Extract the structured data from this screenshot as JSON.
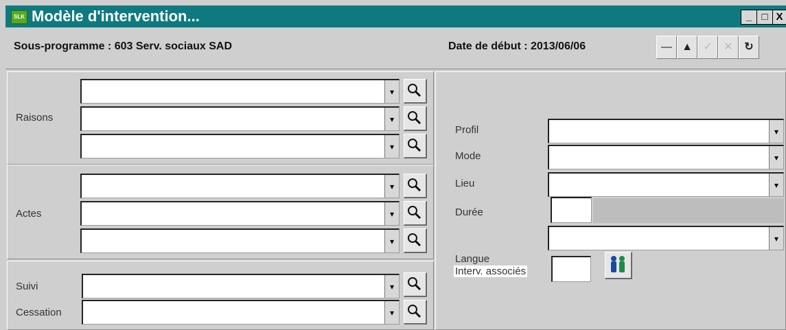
{
  "window": {
    "title": "Modèle d'intervention...",
    "app_icon_text": "SLK",
    "controls": {
      "minimize": "_",
      "maximize": "□",
      "close": "X"
    }
  },
  "header": {
    "subprogram": "Sous-programme : 603 Serv. sociaux SAD",
    "start_date": "Date de début : 2013/06/06",
    "toolbar": {
      "remove": {
        "icon": "minus-icon",
        "glyph": "—",
        "enabled": true
      },
      "up": {
        "icon": "triangle-up-icon",
        "glyph": "▲",
        "enabled": true
      },
      "confirm": {
        "icon": "check-icon",
        "glyph": "✓",
        "enabled": false
      },
      "cancel": {
        "icon": "x-icon",
        "glyph": "✕",
        "enabled": false
      },
      "refresh": {
        "icon": "refresh-icon",
        "glyph": "↻",
        "enabled": true
      }
    }
  },
  "left": {
    "raisons_label": "Raisons",
    "actes_label": "Actes",
    "suivi_label": "Suivi",
    "cessation_label": "Cessation"
  },
  "right": {
    "profil_label": "Profil",
    "mode_label": "Mode",
    "lieu_label": "Lieu",
    "duree_label": "Durée",
    "langue_label": "Langue",
    "interv_label": "Interv. associés"
  },
  "dropdown_glyph": "▾",
  "colors": {
    "titlebar": "#0e7a80",
    "face": "#cfcfcf"
  }
}
